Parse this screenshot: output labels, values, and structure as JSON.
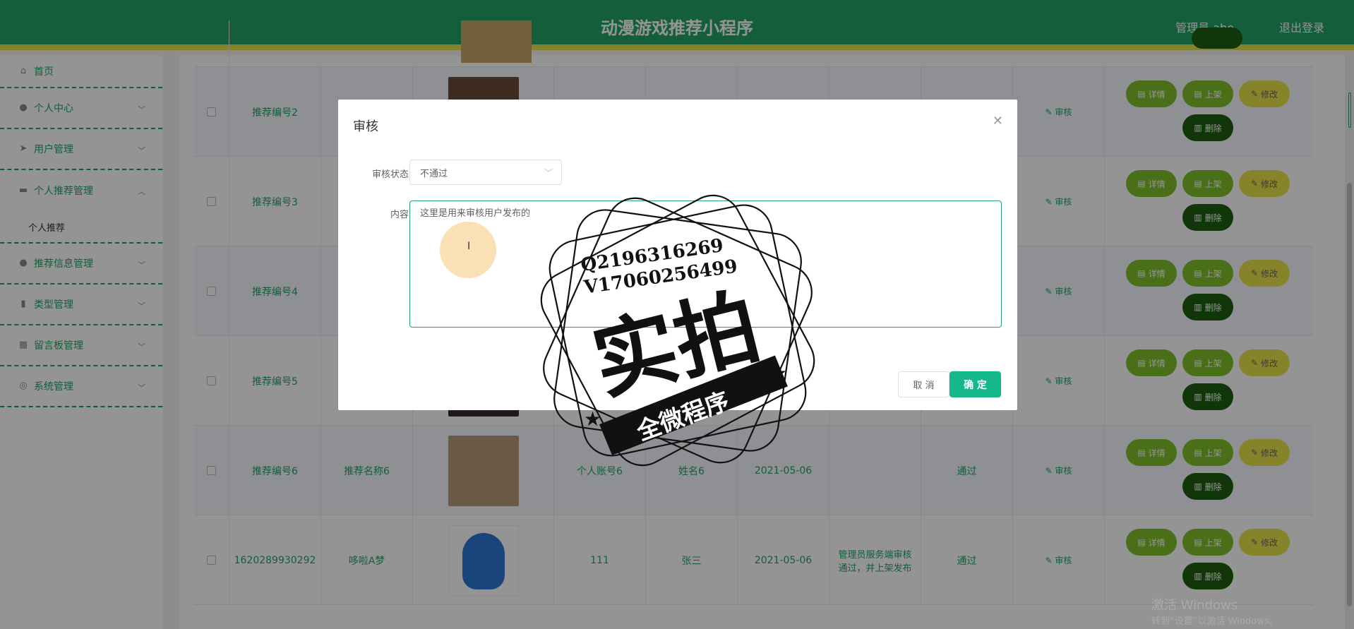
{
  "header": {
    "title": "动漫游戏推荐小程序",
    "user": "管理员 abo",
    "logout": "退出登录"
  },
  "sidebar": {
    "items": [
      {
        "label": "首页",
        "icon": "home-icon"
      },
      {
        "label": "个人中心",
        "icon": "person-icon"
      },
      {
        "label": "用户管理",
        "icon": "send-icon"
      },
      {
        "label": "个人推荐管理",
        "icon": "briefcase-icon"
      },
      {
        "label": "推荐信息管理",
        "icon": "person-icon"
      },
      {
        "label": "类型管理",
        "icon": "bar-chart-icon"
      },
      {
        "label": "留言板管理",
        "icon": "grid-icon"
      },
      {
        "label": "系统管理",
        "icon": "settings-icon"
      }
    ],
    "sub_item": "个人推荐"
  },
  "table": {
    "rows": [
      {
        "id": "推荐编号2",
        "name": "",
        "account": "",
        "person": "",
        "date": "",
        "remark": "",
        "status": "",
        "review": "审核"
      },
      {
        "id": "推荐编号3",
        "name": "",
        "account": "",
        "person": "",
        "date": "",
        "remark": "",
        "status": "",
        "review": "审核"
      },
      {
        "id": "推荐编号4",
        "name": "",
        "account": "",
        "person": "",
        "date": "",
        "remark": "",
        "status": "",
        "review": "审核"
      },
      {
        "id": "推荐编号5",
        "name": "",
        "account": "",
        "person": "",
        "date": "",
        "remark": "",
        "status": "",
        "review": "审核"
      },
      {
        "id": "推荐编号6",
        "name": "推荐名称6",
        "account": "个人账号6",
        "person": "姓名6",
        "date": "2021-05-06",
        "remark": "",
        "status": "通过",
        "review": "审核"
      },
      {
        "id": "1620289930292",
        "name": "哆啦A梦",
        "account": "111",
        "person": "张三",
        "date": "2021-05-06",
        "remark": "管理员服务端审核通过，并上架发布",
        "status": "通过",
        "review": "审核"
      }
    ],
    "buttons": {
      "detail": "详情",
      "up": "上架",
      "edit": "修改",
      "delete": "删除"
    }
  },
  "dialog": {
    "title": "审核",
    "status_label": "审核状态",
    "status_value": "不通过",
    "content_label": "内容",
    "content_value": "这里是用来审核用户发布的",
    "cancel": "取 消",
    "ok": "确 定"
  },
  "watermark": {
    "line1": "Q2196316269",
    "line2": "V17060256499",
    "big": "实拍",
    "ribbon": "全微程序"
  },
  "windows": {
    "line1": "激活 Windows",
    "line2": "转到“设置”以激活 Windows。"
  },
  "colors": {
    "primary": "#23a367",
    "yellow": "#e8e24a",
    "ok": "#14b88a"
  }
}
